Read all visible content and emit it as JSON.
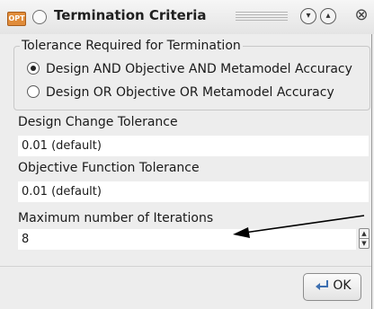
{
  "window": {
    "app_icon_text": "OPT",
    "title": "Termination Criteria",
    "title_buttons": [
      "minimize-icon",
      "maximize-icon",
      "close-icon"
    ]
  },
  "tolerance_group": {
    "legend": "Tolerance Required for Termination",
    "options": [
      {
        "label": "Design AND Objective AND Metamodel Accuracy",
        "selected": true
      },
      {
        "label": "Design OR Objective OR Metamodel Accuracy",
        "selected": false
      }
    ]
  },
  "fields": {
    "design_change": {
      "label": "Design Change Tolerance",
      "value": "0.01 (default)"
    },
    "objective_function": {
      "label": "Objective Function Tolerance",
      "value": "0.01 (default)"
    },
    "max_iterations": {
      "label": "Maximum number of Iterations",
      "value": "8"
    }
  },
  "buttons": {
    "ok": "OK",
    "ok_icon": "ok-return-icon"
  }
}
